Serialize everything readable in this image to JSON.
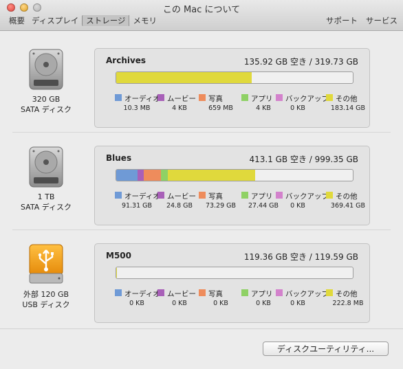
{
  "window": {
    "title": "この Mac について"
  },
  "tabs": [
    "概要",
    "ディスプレイ",
    "ストレージ",
    "メモリ"
  ],
  "links": [
    "サポート",
    "サービス"
  ],
  "legend_labels": [
    "オーディオ",
    "ムービー",
    "写真",
    "アプリ",
    "バックアップ",
    "その他"
  ],
  "colors": {
    "audio": "#6f9ad6",
    "movies": "#a860b8",
    "photos": "#ee8c5c",
    "apps": "#8fd165",
    "backups": "#d382cc",
    "other": "#e0d93c",
    "usb_drive": "#f2a21c"
  },
  "disks": [
    {
      "icon": "hard-drive-icon",
      "size_label": "320 GB",
      "type_label": "SATA ディスク",
      "volume": "Archives",
      "space": "135.92 GB 空き / 319.73 GB",
      "usage_fraction": {
        "audio": 0,
        "movies": 0,
        "photos": 0,
        "apps": 0,
        "backups": 0,
        "other": 0.573
      },
      "values": [
        "10.3 MB",
        "4 KB",
        "659 MB",
        "4 KB",
        "0 KB",
        "183.14 GB"
      ]
    },
    {
      "icon": "hard-drive-icon",
      "size_label": "1 TB",
      "type_label": "SATA ディスク",
      "volume": "Blues",
      "space": "413.1 GB 空き / 999.35 GB",
      "usage_fraction": {
        "audio": 0.0914,
        "movies": 0.0248,
        "photos": 0.0733,
        "apps": 0.0275,
        "backups": 0,
        "other": 0.3696
      },
      "values": [
        "91.31 GB",
        "24.8 GB",
        "73.29 GB",
        "27.44 GB",
        "0 KB",
        "369.41 GB"
      ]
    },
    {
      "icon": "usb-drive-icon",
      "size_label": "外部 120 GB",
      "type_label": "USB ディスク",
      "volume": "M500",
      "space": "119.36 GB 空き / 119.59 GB",
      "usage_fraction": {
        "audio": 0,
        "movies": 0,
        "photos": 0,
        "apps": 0,
        "backups": 0,
        "other": 0.002
      },
      "values": [
        "0 KB",
        "0 KB",
        "0 KB",
        "0 KB",
        "0 KB",
        "222.8 MB"
      ]
    }
  ],
  "disk_utility_button": "ディスクユーティリティ..."
}
